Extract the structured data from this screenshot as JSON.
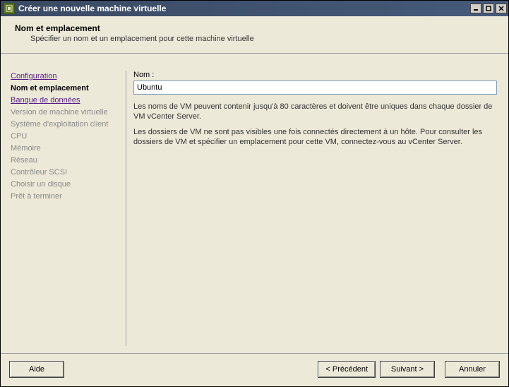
{
  "window": {
    "title": "Créer une nouvelle machine virtuelle"
  },
  "header": {
    "title": "Nom et emplacement",
    "subtitle": "Spécifier un nom et un emplacement pour cette machine virtuelle"
  },
  "sidebar": {
    "steps": [
      {
        "label": "Configuration",
        "state": "link"
      },
      {
        "label": "Nom et emplacement",
        "state": "current"
      },
      {
        "label": "Banque de données",
        "state": "link"
      },
      {
        "label": "Version de machine virtuelle",
        "state": "disabled"
      },
      {
        "label": "Système d'exploitation client",
        "state": "disabled"
      },
      {
        "label": "CPU",
        "state": "disabled"
      },
      {
        "label": "Mémoire",
        "state": "disabled"
      },
      {
        "label": "Réseau",
        "state": "disabled"
      },
      {
        "label": "Contrôleur SCSI",
        "state": "disabled"
      },
      {
        "label": "Choisir un disque",
        "state": "disabled"
      },
      {
        "label": "Prêt à terminer",
        "state": "disabled"
      }
    ]
  },
  "content": {
    "name_label": "Nom :",
    "name_value": "Ubuntu",
    "desc1": "Les noms de VM peuvent contenir jusqu'à 80 caractères et doivent être uniques dans chaque dossier de VM vCenter Server.",
    "desc2": "Les dossiers de VM ne sont pas visibles une fois connectés directement à un hôte. Pour consulter les dossiers de VM et spécifier un emplacement pour cette VM, connectez-vous au vCenter Server."
  },
  "footer": {
    "help": "Aide",
    "back": "< Précédent",
    "next": "Suivant >",
    "cancel": "Annuler"
  }
}
